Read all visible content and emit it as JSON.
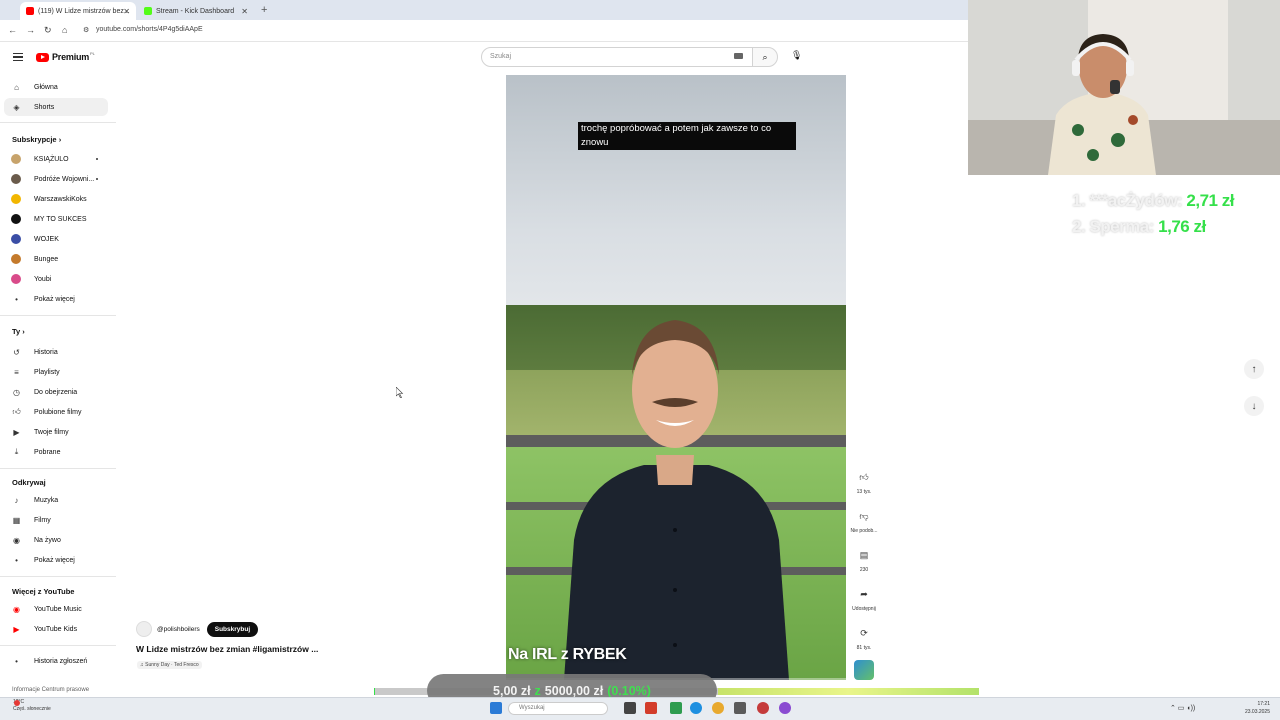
{
  "browser": {
    "tabs": [
      {
        "label": "(119) W Lidze mistrzów bez...",
        "active": true,
        "favicon_color": "#ff0000"
      },
      {
        "label": "Stream - Kick Dashboard",
        "active": false,
        "favicon_color": "#53fc18"
      }
    ],
    "url": "youtube.com/shorts/4P4g5diAApE"
  },
  "youtube": {
    "logo_text": "Premium",
    "logo_region": "PL",
    "search_placeholder": "Szukaj"
  },
  "sidebar": {
    "main": [
      {
        "label": "Główna",
        "icon": "home-icon",
        "selected": false
      },
      {
        "label": "Shorts",
        "icon": "shorts-icon",
        "selected": true
      }
    ],
    "subscriptions_header": "Subskrypcje",
    "subscriptions": [
      {
        "label": "KSIĄŻULO",
        "color": "#c7a36b",
        "dot": true
      },
      {
        "label": "Podróże Wojowni...",
        "color": "#6a5b4b",
        "dot": true
      },
      {
        "label": "WarszawskiKoks",
        "color": "#f2b600",
        "dot": false
      },
      {
        "label": "MY TO SUKCES",
        "color": "#111111",
        "dot": false
      },
      {
        "label": "WOJEK",
        "color": "#3b4ea5",
        "dot": false
      },
      {
        "label": "Bungee",
        "color": "#c47a2c",
        "dot": false
      },
      {
        "label": "Youbi",
        "color": "#d94b8a",
        "dot": false
      }
    ],
    "show_more": "Pokaż więcej",
    "you_header": "Ty",
    "you": [
      {
        "label": "Historia",
        "icon": "history-icon"
      },
      {
        "label": "Playlisty",
        "icon": "playlist-icon"
      },
      {
        "label": "Do obejrzenia",
        "icon": "watch-later-icon"
      },
      {
        "label": "Polubione filmy",
        "icon": "like-icon"
      },
      {
        "label": "Twoje filmy",
        "icon": "your-videos-icon"
      },
      {
        "label": "Pobrane",
        "icon": "download-icon"
      }
    ],
    "explore_header": "Odkrywaj",
    "explore": [
      {
        "label": "Muzyka",
        "icon": "music-icon"
      },
      {
        "label": "Filmy",
        "icon": "film-icon"
      },
      {
        "label": "Na żywo",
        "icon": "live-icon"
      }
    ],
    "show_more_2": "Pokaż więcej",
    "more_header": "Więcej z YouTube",
    "more": [
      {
        "label": "YouTube Music",
        "icon": "youtube-music-icon"
      },
      {
        "label": "YouTube Kids",
        "icon": "youtube-kids-icon"
      }
    ],
    "report_history": "Historia zgłoszeń",
    "footer": "Informacje  Centrum prasowe"
  },
  "short": {
    "caption": "trochę popróbować a potem jak zawsze to co znowu",
    "overlay_title": "Na IRL z RYBEK",
    "channel": "@polishboilers",
    "subscribe_label": "Subskrybuj",
    "title": "W Lidze mistrzów bez zmian #ligamistrzów ...",
    "music": "♫ Sunny Day · Ted Fresco",
    "actions": [
      {
        "name": "like",
        "icon": "thumbs-up-icon",
        "glyph": "👍︎",
        "label": "13 tys."
      },
      {
        "name": "dislike",
        "icon": "thumbs-down-icon",
        "glyph": "👎︎",
        "label": "Nie podob..."
      },
      {
        "name": "comments",
        "icon": "comment-icon",
        "glyph": "▤",
        "label": "230"
      },
      {
        "name": "share",
        "icon": "share-icon",
        "glyph": "➦",
        "label": "Udostępnij"
      },
      {
        "name": "remix",
        "icon": "remix-icon",
        "glyph": "⟳",
        "label": "81 tys."
      }
    ]
  },
  "stream_overlay": {
    "donations": [
      {
        "rank_name": "1. ***acŻydów:",
        "amount": "2,71 zł"
      },
      {
        "rank_name": "2. Sperma:",
        "amount": "1,76 zł"
      }
    ],
    "goal_current": "5,00 zł",
    "goal_sep": "z",
    "goal_target": "5000,00 zł",
    "goal_percent": "(0.10%)",
    "goal_fraction": 0.001
  },
  "taskbar": {
    "weather_temp": "12°C",
    "weather_desc": "Częś. słonecznie",
    "search_label": "Wyszukaj",
    "time": "17:21",
    "date": "23.03.2025"
  },
  "colors": {
    "youtube_red": "#ff0000",
    "donation_green": "#35e04a",
    "kick_green": "#53fc18"
  }
}
